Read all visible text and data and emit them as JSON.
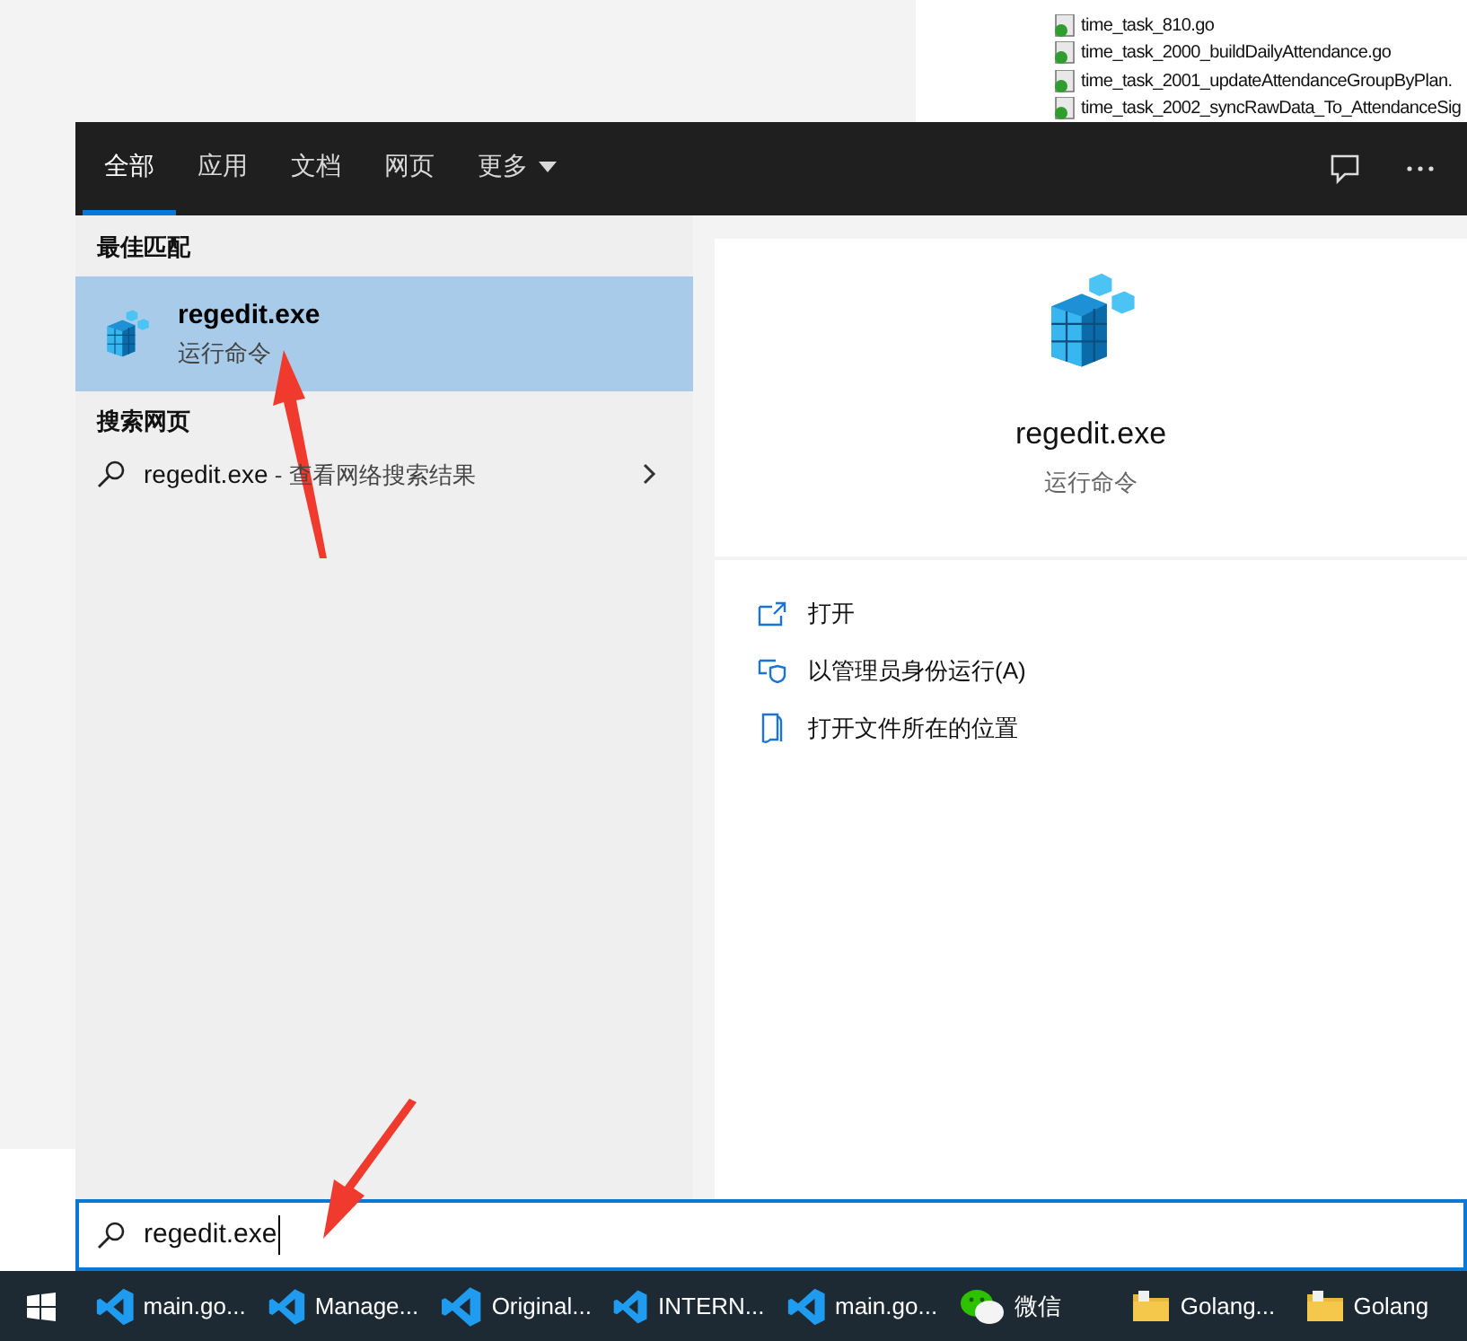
{
  "background_files": [
    {
      "name": "time_task_810.go"
    },
    {
      "name": "time_task_2000_buildDailyAttendance.go"
    },
    {
      "name": "time_task_2001_updateAttendanceGroupByPlan."
    },
    {
      "name": "time_task_2002_syncRawData_To_AttendanceSig"
    }
  ],
  "search_window": {
    "tabs": [
      {
        "label": "全部",
        "selected": true
      },
      {
        "label": "应用",
        "selected": false
      },
      {
        "label": "文档",
        "selected": false
      },
      {
        "label": "网页",
        "selected": false
      },
      {
        "label": "更多",
        "selected": false,
        "dropdown": true
      }
    ],
    "best_match": {
      "heading": "最佳匹配",
      "name": "regedit.exe",
      "subtitle": "运行命令",
      "selected": true
    },
    "web_search": {
      "heading": "搜索网页",
      "query": "regedit.exe",
      "suffix": " - 查看网络搜索结果"
    },
    "detail": {
      "name": "regedit.exe",
      "subtitle": "运行命令",
      "actions": [
        {
          "kind": "open",
          "label": "打开"
        },
        {
          "kind": "admin",
          "label": "以管理员身份运行(A)"
        },
        {
          "kind": "location",
          "label": "打开文件所在的位置"
        }
      ]
    },
    "search_box": {
      "value": "regedit.exe"
    }
  },
  "taskbar": [
    {
      "kind": "vscode",
      "label": "main.go..."
    },
    {
      "kind": "vscode",
      "label": "Manage..."
    },
    {
      "kind": "vscode",
      "label": "Original..."
    },
    {
      "kind": "vscode",
      "label": "INTERN..."
    },
    {
      "kind": "vscode",
      "label": "main.go..."
    },
    {
      "kind": "wechat",
      "label": "微信"
    },
    {
      "kind": "folder",
      "label": "Golang..."
    },
    {
      "kind": "folder",
      "label": "Golang"
    }
  ]
}
